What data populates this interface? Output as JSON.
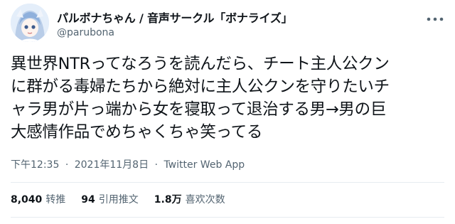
{
  "tweet": {
    "display_name": "パルボナちゃん / 音声サークル「ボナライズ」",
    "handle": "@parubona",
    "text_lines": [
      "異世界NTRってなろうを読んだら、チート主人公クン",
      "に群がる毒婦たちから絶対に主人公クンを守りたいチ",
      "ャラ男が片っ端から女を寝取って退治する男→男の巨",
      "大感情作品でめちゃくちゃ笑ってる"
    ],
    "time": "下午12:35",
    "date": "2021年11月8日",
    "source": "Twitter Web App",
    "separator": "·",
    "stats": [
      {
        "value": "8,040",
        "label": "转推"
      },
      {
        "value": "94",
        "label": "引用推文"
      },
      {
        "value": "1.8万",
        "label": "喜欢次数"
      }
    ]
  },
  "icons": {
    "avatar": "anime-avatar",
    "more": "more-dots-icon"
  },
  "colors": {
    "text": "#0f1419",
    "secondary": "#536471",
    "divider": "#e6ecf0"
  }
}
